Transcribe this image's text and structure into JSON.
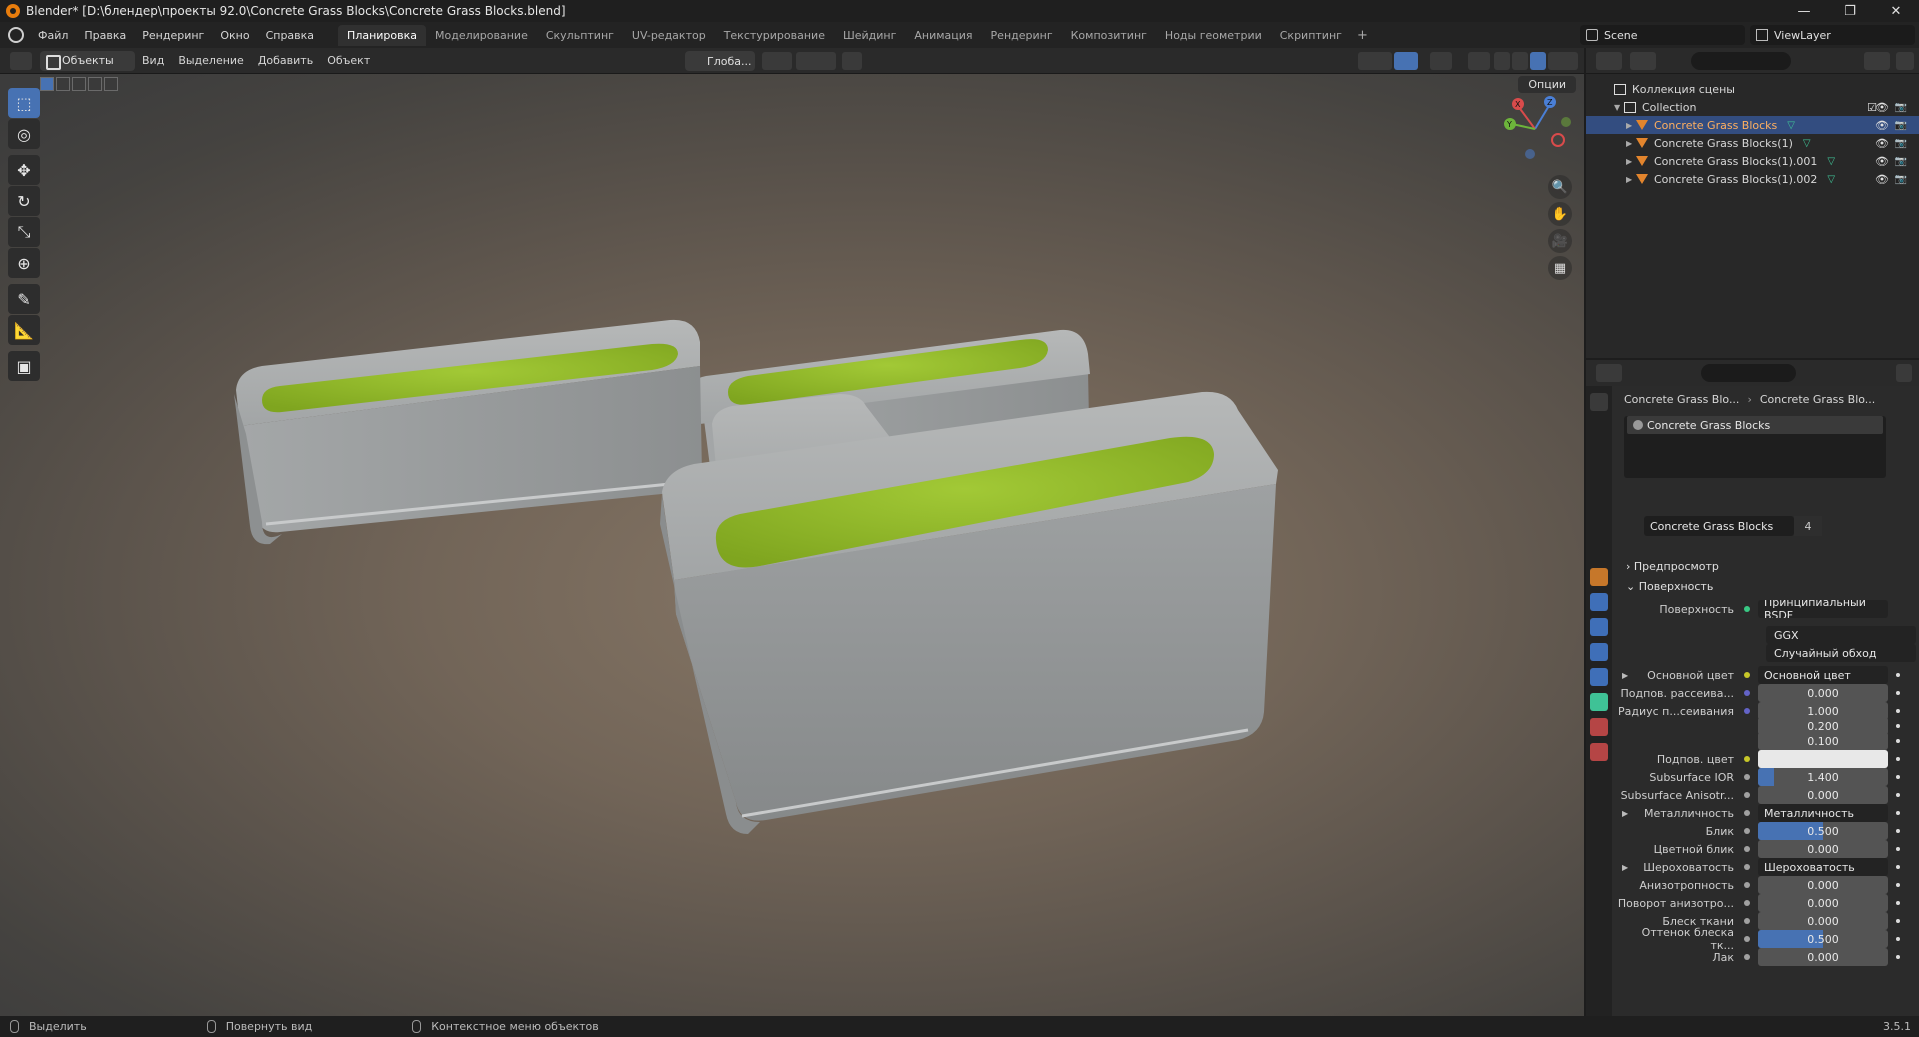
{
  "window": {
    "title": "Blender* [D:\\блендер\\проекты 92.0\\Concrete Grass Blocks\\Concrete Grass Blocks.blend]",
    "min": "—",
    "max": "❐",
    "close": "✕"
  },
  "menu": [
    "Файл",
    "Правка",
    "Рендеринг",
    "Окно",
    "Справка"
  ],
  "workspaces": [
    "Планировка",
    "Моделирование",
    "Скульптинг",
    "UV-редактор",
    "Текстурирование",
    "Шейдинг",
    "Анимация",
    "Рендеринг",
    "Композитинг",
    "Ноды геометрии",
    "Скриптинг"
  ],
  "workspace_plus": "+",
  "scene": "Scene",
  "view_layer": "ViewLayer",
  "viewport_header": {
    "mode": "Объекты",
    "menus": [
      "Вид",
      "Выделение",
      "Добавить",
      "Объект"
    ],
    "orientation": "Глоба...",
    "options": "Опции"
  },
  "gizmo": {
    "x": "X",
    "y": "Y",
    "z": "Z"
  },
  "outliner": {
    "scene_collection": "Коллекция сцены",
    "collection": "Collection",
    "objects": [
      "Concrete Grass Blocks",
      "Concrete Grass Blocks(1)",
      "Concrete Grass Blocks(1).001",
      "Concrete Grass Blocks(1).002"
    ]
  },
  "properties": {
    "breadcrumb": [
      "Concrete Grass Blo...",
      "Concrete Grass Blo..."
    ],
    "slot": "Concrete Grass Blocks",
    "material": "Concrete Grass Blocks",
    "users": "4",
    "sections": {
      "preview": "Предпросмотр",
      "surface": "Поверхность"
    },
    "surface_label": "Поверхность",
    "surface_shader": "Принципиальный BSDF",
    "distribution": "GGX",
    "subsurface_method": "Случайный обход",
    "rows": [
      {
        "label": "Основной цвет",
        "value": "Основной цвет",
        "kind": "link",
        "dot": "#c7c729",
        "tri": true
      },
      {
        "label": "Подпов. рассеива...",
        "value": "0.000",
        "kind": "num",
        "dot": "#6363c7",
        "fill": 0
      },
      {
        "label": "Радиус п...сеивания",
        "value": "1.000",
        "kind": "num",
        "dot": "#6363c7",
        "fill": 0
      },
      {
        "label": "",
        "value": "0.200",
        "kind": "num",
        "dot": "",
        "fill": 0
      },
      {
        "label": "",
        "value": "0.100",
        "kind": "num",
        "dot": "",
        "fill": 0
      },
      {
        "label": "Подпов. цвет",
        "value": "",
        "kind": "color",
        "dot": "#c7c729"
      },
      {
        "label": "Subsurface IOR",
        "value": "1.400",
        "kind": "num",
        "dot": "#a1a1a1",
        "fill": 0.12
      },
      {
        "label": "Subsurface Anisotr...",
        "value": "0.000",
        "kind": "num",
        "dot": "#a1a1a1",
        "fill": 0
      },
      {
        "label": "Металличность",
        "value": "Металличность",
        "kind": "link",
        "dot": "#a1a1a1",
        "tri": true
      },
      {
        "label": "Блик",
        "value": "0.500",
        "kind": "num",
        "dot": "#a1a1a1",
        "fill": 0.5
      },
      {
        "label": "Цветной блик",
        "value": "0.000",
        "kind": "num",
        "dot": "#a1a1a1",
        "fill": 0
      },
      {
        "label": "Шероховатость",
        "value": "Шероховатость",
        "kind": "link",
        "dot": "#a1a1a1",
        "tri": true
      },
      {
        "label": "Анизотропность",
        "value": "0.000",
        "kind": "num",
        "dot": "#a1a1a1",
        "fill": 0
      },
      {
        "label": "Поворот анизотро...",
        "value": "0.000",
        "kind": "num",
        "dot": "#a1a1a1",
        "fill": 0
      },
      {
        "label": "Блеск ткани",
        "value": "0.000",
        "kind": "num",
        "dot": "#a1a1a1",
        "fill": 0
      },
      {
        "label": "Оттенок блеска тк...",
        "value": "0.500",
        "kind": "num",
        "dot": "#a1a1a1",
        "fill": 0.5
      },
      {
        "label": "Лак",
        "value": "0.000",
        "kind": "num",
        "dot": "#a1a1a1",
        "fill": 0
      }
    ]
  },
  "statusbar": {
    "select": "Выделить",
    "rotate": "Повернуть вид",
    "context": "Контекстное меню объектов",
    "version": "3.5.1"
  },
  "colors": {
    "accent": "#4772b3",
    "selected_row": "#334d80",
    "object_icon": "#e3852d",
    "mesh_icon": "#3fc296",
    "grass": "#8db82a",
    "concrete": "#9a9d9e"
  }
}
